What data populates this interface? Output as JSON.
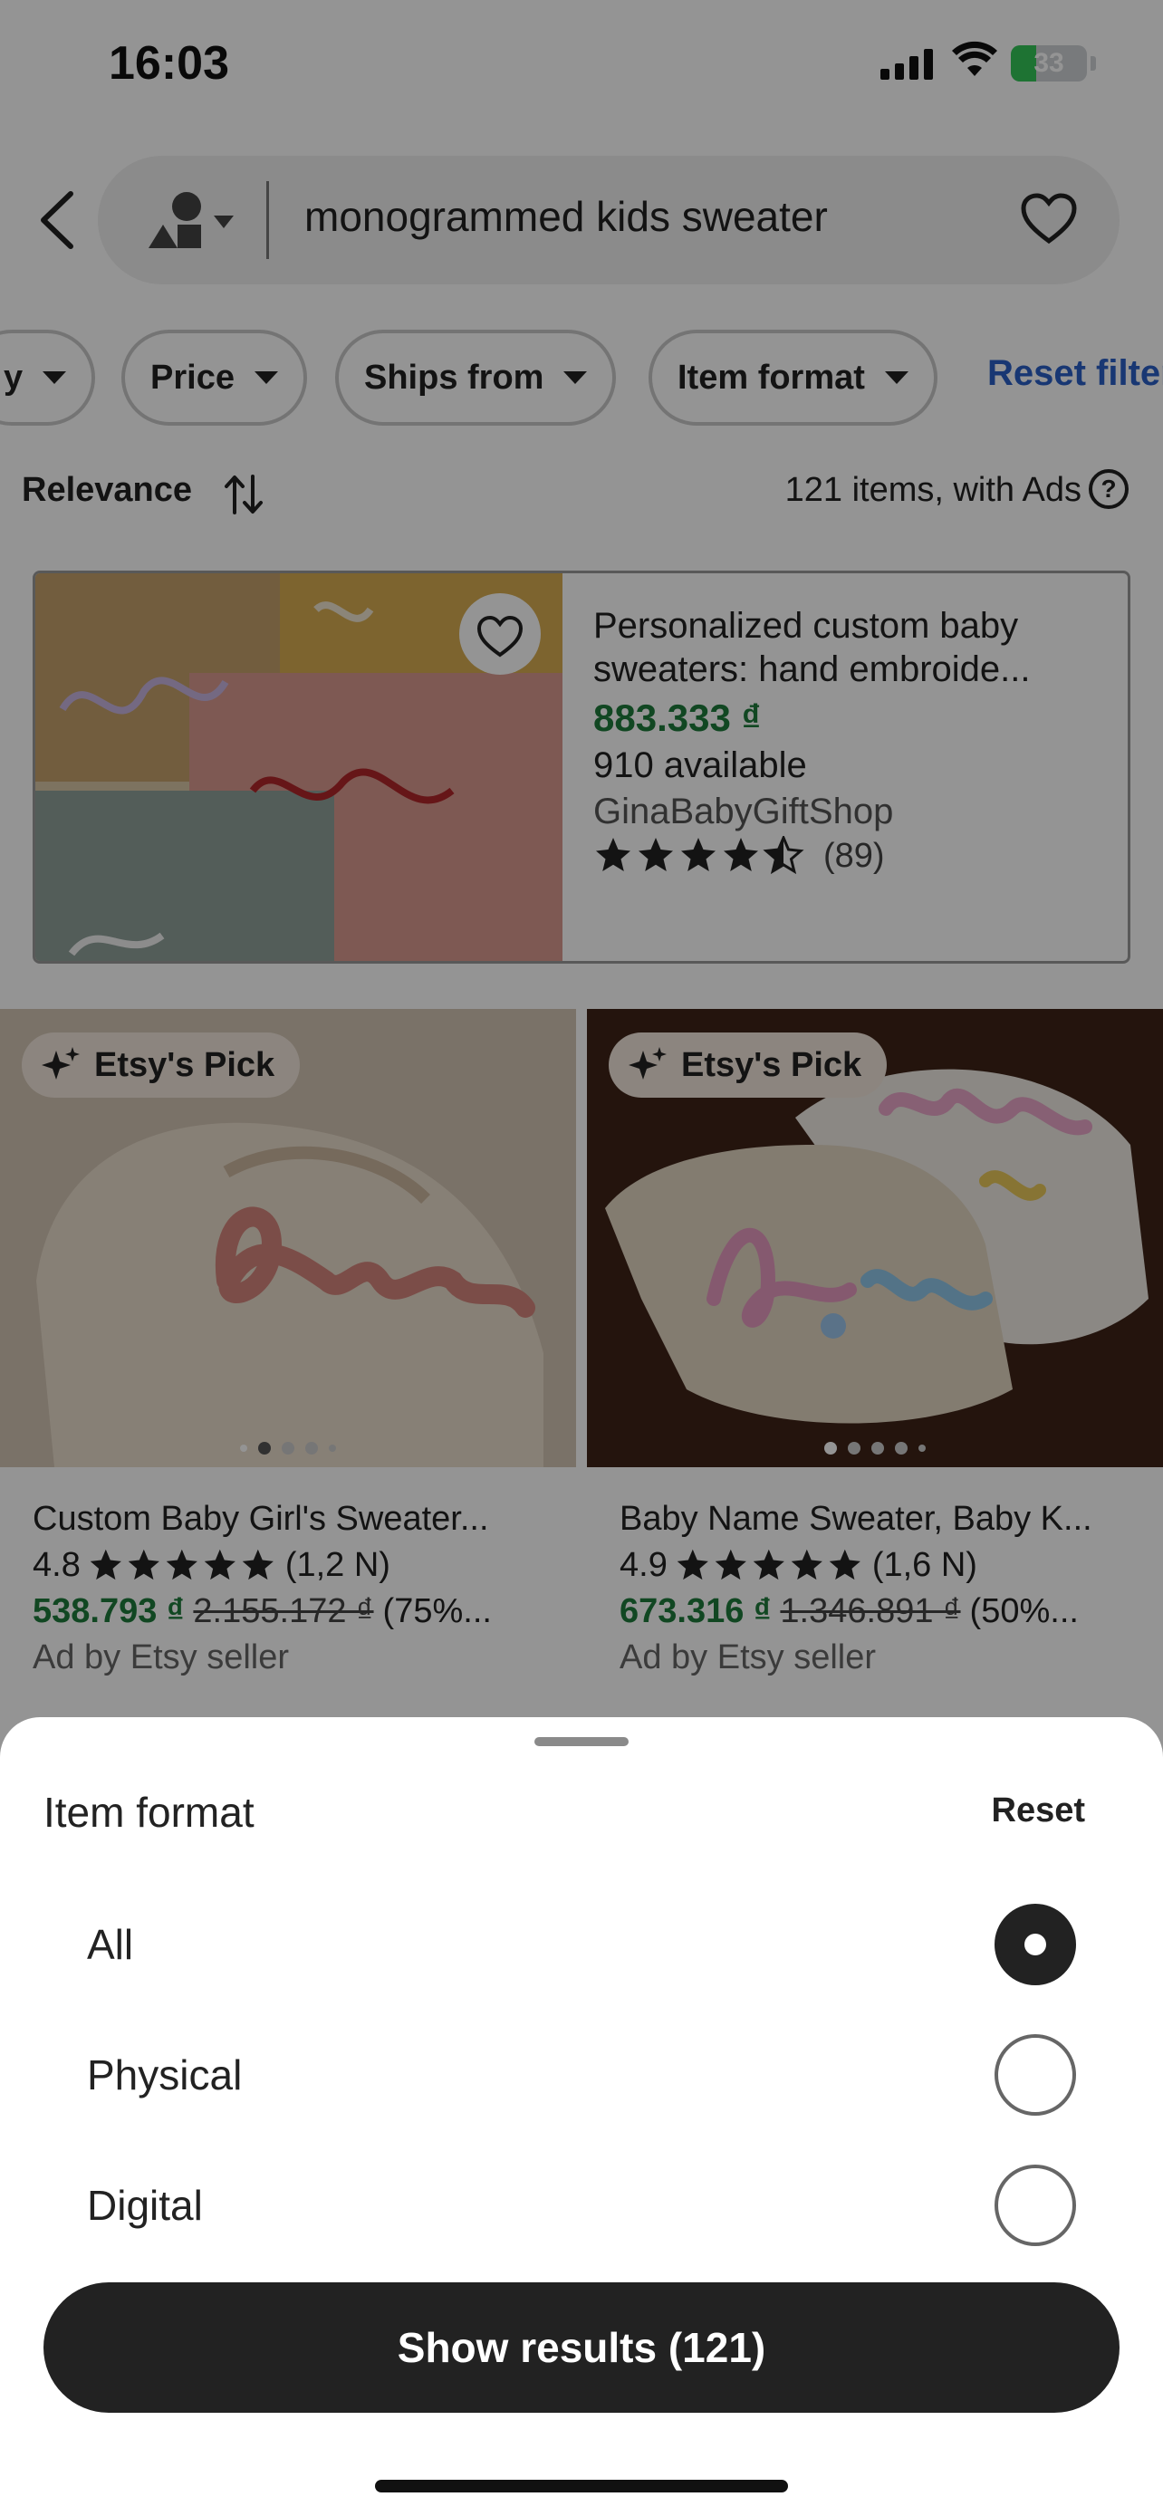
{
  "status_bar": {
    "time": "16:03",
    "battery": "33",
    "battery_level": 0.33
  },
  "search": {
    "query": "monogrammed kids sweater"
  },
  "filters": {
    "chips": [
      "y",
      "Price",
      "Ships from",
      "Item format"
    ],
    "reset_label": "Reset filters"
  },
  "sort": {
    "label": "Relevance",
    "count_text": "121 items, with Ads",
    "help_glyph": "?"
  },
  "ad_listing": {
    "title": "Personalized custom baby sweaters: hand embroide...",
    "price": "883.333 ₫",
    "availability": "910 available",
    "shop": "GinaBabyGiftShop",
    "rating": 4.5,
    "review_count": "(89)"
  },
  "products": [
    {
      "badge": "Etsy's Pick",
      "title": "Custom Baby Girl's Sweater...",
      "rating": "4.8",
      "reviews": "(1,2 N)",
      "price": "538.793 ₫",
      "original_price": "2.155.172 ₫",
      "discount": "(75%...",
      "ad_label": "Ad by Etsy seller"
    },
    {
      "badge": "Etsy's Pick",
      "title": "Baby Name Sweater, Baby K...",
      "rating": "4.9",
      "reviews": "(1,6 N)",
      "price": "673.316 ₫",
      "original_price": "1.346.891 ₫",
      "discount": "(50%...",
      "ad_label": "Ad by Etsy seller"
    }
  ],
  "sheet": {
    "title": "Item format",
    "reset_label": "Reset",
    "options": [
      {
        "label": "All",
        "selected": true
      },
      {
        "label": "Physical",
        "selected": false
      },
      {
        "label": "Digital",
        "selected": false
      }
    ],
    "submit_label": "Show results (121)"
  },
  "colors": {
    "price_green": "#1e7a3c",
    "link_blue": "#2a5fc7",
    "button_dark": "#222222",
    "overlay": "rgba(0,0,0,0.42)"
  }
}
